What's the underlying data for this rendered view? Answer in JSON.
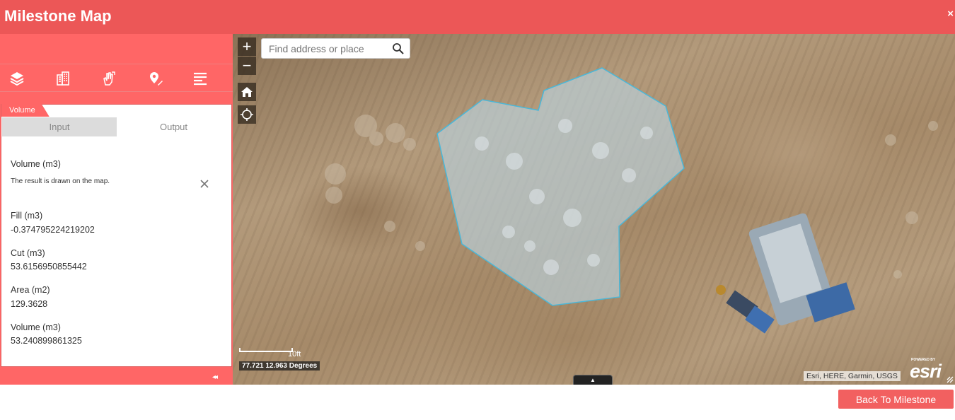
{
  "app": {
    "title": "Milestone Map",
    "close_glyph": "×"
  },
  "toolbar": {
    "icons": [
      "layers-icon",
      "building-icon",
      "measure-hand-icon",
      "pin-edit-icon",
      "list-icon"
    ]
  },
  "panel": {
    "tab_label": "Volume",
    "subtabs": {
      "input": "Input",
      "output": "Output"
    },
    "heading": "Volume (m3)",
    "note": "The result is drawn on the map.",
    "results": [
      {
        "label": "Fill (m3)",
        "value": "-0.374795224219202"
      },
      {
        "label": "Cut (m3)",
        "value": "53.6156950855442"
      },
      {
        "label": "Area (m2)",
        "value": "129.3628"
      },
      {
        "label": "Volume (m3)",
        "value": "53.240899861325"
      }
    ],
    "collapse_glyph": "◂◂"
  },
  "map": {
    "search_placeholder": "Find address or place",
    "zoom_in": "+",
    "zoom_out": "−",
    "scale_label": "10ft",
    "coords": "77.721 12.963 Degrees",
    "attribution": "Esri, HERE, Garmin, USGS",
    "powered_by": "POWERED BY",
    "esri_logo": "esri",
    "expand_glyph": "▲",
    "polygon_fill": "#b9cdd6",
    "polygon_stroke": "#4ab7d8"
  },
  "footer": {
    "back_label": "Back To Milestone"
  },
  "colors": {
    "header": "#ec5757",
    "sidebar": "#ff6666",
    "button": "#f26060"
  }
}
